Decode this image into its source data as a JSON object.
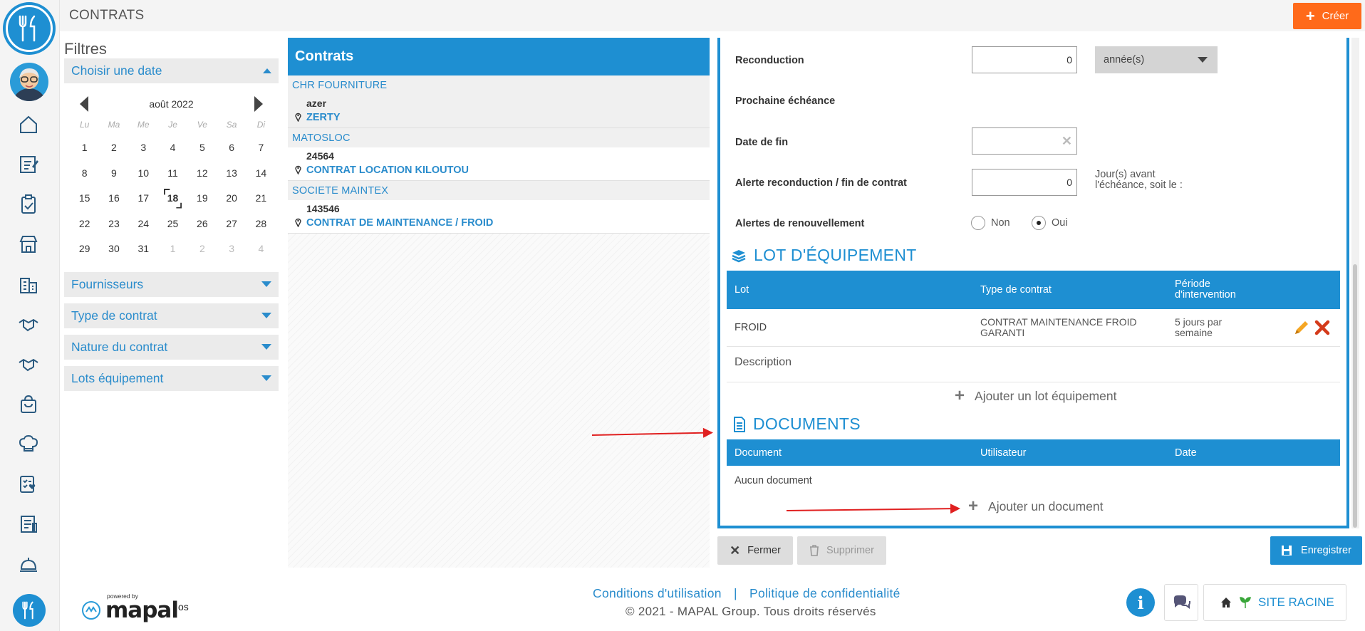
{
  "header": {
    "title": "CONTRATS",
    "create_label": "Créer"
  },
  "filters": {
    "title": "Filtres",
    "date_section": "Choisir une date",
    "calendar": {
      "month": "août 2022",
      "weekdays": [
        "Lu",
        "Ma",
        "Me",
        "Je",
        "Ve",
        "Sa",
        "Di"
      ],
      "weeks": [
        [
          "1",
          "2",
          "3",
          "4",
          "5",
          "6",
          "7"
        ],
        [
          "8",
          "9",
          "10",
          "11",
          "12",
          "13",
          "14"
        ],
        [
          "15",
          "16",
          "17",
          "18",
          "19",
          "20",
          "21"
        ],
        [
          "22",
          "23",
          "24",
          "25",
          "26",
          "27",
          "28"
        ],
        [
          "29",
          "30",
          "31",
          "1",
          "2",
          "3",
          "4"
        ]
      ],
      "selected_day": "18"
    },
    "sections": [
      "Fournisseurs",
      "Type de contrat",
      "Nature du contrat",
      "Lots équipement"
    ]
  },
  "contracts": {
    "title": "Contrats",
    "groups": [
      {
        "supplier": "CHR FOURNITURE",
        "items": [
          {
            "code": "azer",
            "name": "ZERTY"
          }
        ]
      },
      {
        "supplier": "MATOSLOC",
        "items": [
          {
            "code": "24564",
            "name": "CONTRAT LOCATION KILOUTOU"
          }
        ]
      },
      {
        "supplier": "SOCIETE MAINTEX",
        "items": [
          {
            "code": "143546",
            "name": "CONTRAT DE MAINTENANCE / FROID"
          }
        ]
      }
    ]
  },
  "detail": {
    "reconduction_label": "Reconduction",
    "reconduction_value": "0",
    "reconduction_unit": "année(s)",
    "next_due_label": "Prochaine échéance",
    "end_date_label": "Date de fin",
    "end_date_value": "",
    "alert_label": "Alerte reconduction / fin de contrat",
    "alert_value": "0",
    "alert_hint_line1": "Jour(s) avant",
    "alert_hint_line2": "l'échéance, soit le :",
    "renewal_label": "Alertes de renouvellement",
    "renewal_no": "Non",
    "renewal_yes": "Oui",
    "renewal_selected": "Oui",
    "lot_section_title": "LOT D'ÉQUIPEMENT",
    "lot_columns": [
      "Lot",
      "Type de contrat",
      "Période d'intervention"
    ],
    "lot_column3_line1": "Période",
    "lot_column3_line2": "d'intervention",
    "lot_rows": [
      {
        "lot": "FROID",
        "type_line1": "CONTRAT MAINTENANCE FROID",
        "type_line2": "GARANTI",
        "period_line1": "5 jours par",
        "period_line2": "semaine"
      }
    ],
    "description_label": "Description",
    "add_lot_label": "Ajouter un lot équipement",
    "documents_title": "DOCUMENTS",
    "doc_columns": [
      "Document",
      "Utilisateur",
      "Date"
    ],
    "no_document": "Aucun document",
    "add_document_label": "Ajouter un document"
  },
  "actions": {
    "close_label": "Fermer",
    "delete_label": "Supprimer",
    "save_label": "Enregistrer"
  },
  "footer": {
    "terms": "Conditions d'utilisation",
    "separator": "|",
    "privacy": "Politique de confidentialité",
    "copyright": "© 2021 - MAPAL Group. Tous droits réservés",
    "powered_by": "powered by",
    "brand": "mapal",
    "brand_suffix": "os",
    "site_button": "SITE RACINE"
  },
  "colors": {
    "primary": "#1e8fd2",
    "create_button": "#ff6a1a",
    "annotation_arrow": "#e02020"
  }
}
